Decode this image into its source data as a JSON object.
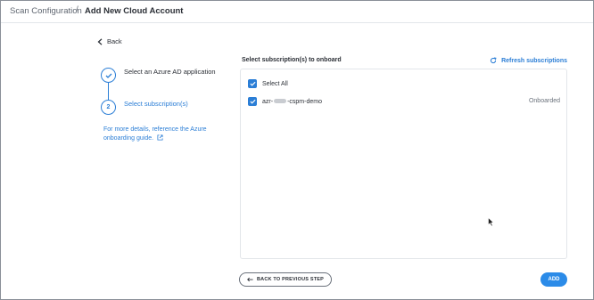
{
  "breadcrumb": {
    "parent": "Scan Configuration",
    "separator": "/",
    "current": "Add New Cloud Account"
  },
  "back_label": "Back",
  "steps": [
    {
      "number": "",
      "label": "Select an Azure AD application",
      "state": "completed"
    },
    {
      "number": "2",
      "label": "Select subscription(s)",
      "state": "active"
    }
  ],
  "guide_link": "For more details, reference the Azure onboarding guide.",
  "panel": {
    "title": "Select subscription(s) to onboard",
    "refresh_label": "Refresh subscriptions",
    "select_all_label": "Select All",
    "subscriptions": [
      {
        "name_prefix": "azr-",
        "name_suffix": "-cspm-demo",
        "status": "Onboarded",
        "checked": true
      }
    ]
  },
  "buttons": {
    "previous": "BACK TO PREVIOUS STEP",
    "add": "ADD"
  },
  "colors": {
    "accent": "#2b7ed6",
    "primary_button": "#2b8be8"
  }
}
